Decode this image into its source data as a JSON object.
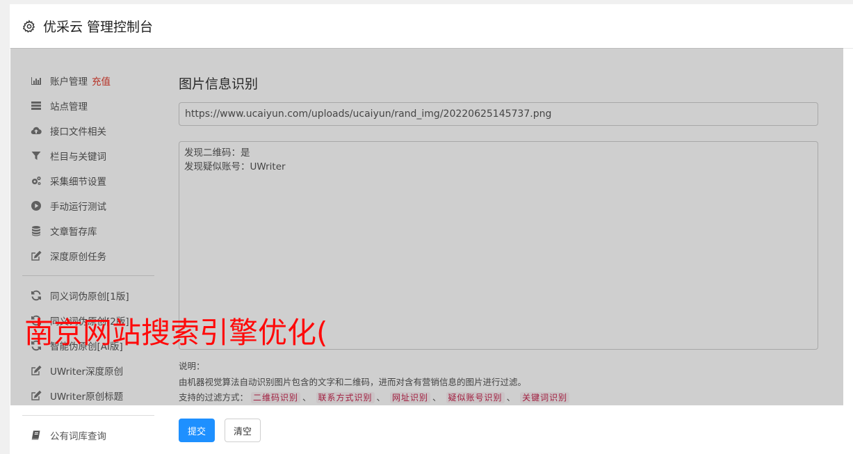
{
  "header": {
    "title": "优采云 管理控制台"
  },
  "sidebar": {
    "items": [
      {
        "label": "账户管理",
        "highlight": "充值",
        "icon": "bar-chart-icon"
      },
      {
        "label": "站点管理",
        "icon": "server-icon"
      },
      {
        "label": "接口文件相关",
        "icon": "cloud-upload-icon"
      },
      {
        "label": "栏目与关键词",
        "icon": "filter-icon"
      },
      {
        "label": "采集细节设置",
        "icon": "cogs-icon"
      },
      {
        "label": "手动运行测试",
        "icon": "play-circle-icon"
      },
      {
        "label": "文章暂存库",
        "icon": "database-icon"
      },
      {
        "label": "深度原创任务",
        "icon": "edit-icon"
      }
    ],
    "tools": [
      {
        "label": "同义词伪原创[1版]",
        "icon": "refresh-icon"
      },
      {
        "label": "同义词伪原创[2版]",
        "icon": "refresh-icon"
      },
      {
        "label": "智能伪原创[AI版]",
        "icon": "refresh-icon"
      },
      {
        "label": "UWriter深度原创",
        "icon": "edit-icon"
      },
      {
        "label": "UWriter原创标题",
        "icon": "edit-icon"
      }
    ],
    "bottom": [
      {
        "label": "公有词库查询",
        "icon": "book-icon"
      }
    ]
  },
  "main": {
    "title": "图片信息识别",
    "url_value": "https://www.ucaiyun.com/uploads/ucaiyun/rand_img/20220625145737.png",
    "result_lines": [
      "发现二维码：是",
      "发现疑似账号：UWriter"
    ],
    "notes_label": "说明：",
    "notes_desc": "由机器视觉算法自动识别图片包含的文字和二维码，进而对含有营销信息的图片进行过滤。",
    "filter_label": "支持的过滤方式：",
    "filters": [
      "二维码识别",
      "联系方式识别",
      "网址识别",
      "疑似账号识别",
      "关键词识别"
    ],
    "separator": "、"
  },
  "buttons": {
    "submit": "提交",
    "clear": "清空"
  },
  "watermark": "南京网站搜索引擎优化("
}
